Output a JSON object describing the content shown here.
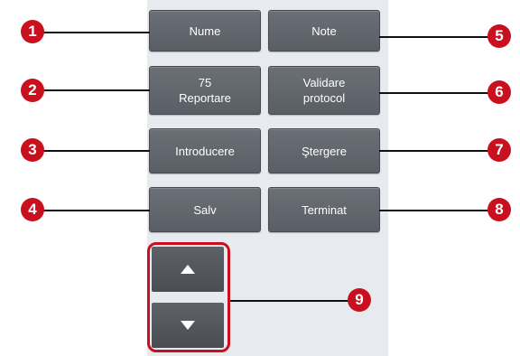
{
  "buttons": {
    "name": "Nume",
    "notes": "Note",
    "report_line1": "75",
    "report_line2": "Reportare",
    "validate_line1": "Validare",
    "validate_line2": "protocol",
    "insert": "Introducere",
    "delete": "Ştergere",
    "save": "Salv",
    "done": "Terminat"
  },
  "callouts": [
    "1",
    "2",
    "3",
    "4",
    "5",
    "6",
    "7",
    "8",
    "9"
  ],
  "colors": {
    "callout": "#c8101f",
    "button": "#5f636a",
    "panel": "#e7ebf0"
  },
  "icons": {
    "scroll_up": "triangle-up-icon",
    "scroll_down": "triangle-down-icon"
  }
}
